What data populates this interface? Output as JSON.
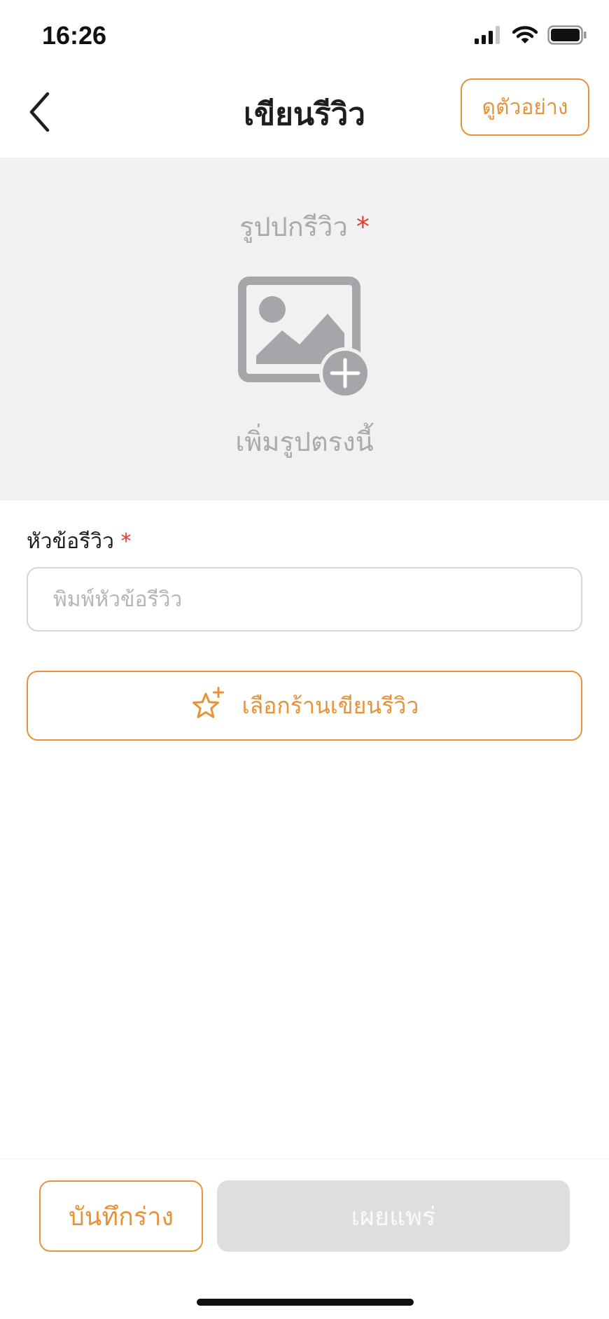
{
  "status_bar": {
    "time": "16:26"
  },
  "header": {
    "back_icon": "chevron-left-icon",
    "title": "เขียนรีวิว",
    "preview_label": "ดูตัวอย่าง"
  },
  "cover": {
    "label": "รูปปกรีวิว",
    "required_mark": "*",
    "icon": "add-image-icon",
    "hint": "เพิ่มรูปตรงนี้"
  },
  "title_field": {
    "label": "หัวข้อรีวิว",
    "required_mark": "*",
    "value": "",
    "placeholder": "พิมพ์หัวข้อรีวิว"
  },
  "shop_button": {
    "icon": "star-plus-icon",
    "label": "เลือกร้านเขียนรีวิว"
  },
  "footer": {
    "draft_label": "บันทึกร่าง",
    "publish_label": "เผยแพร่"
  },
  "colors": {
    "accent": "#e8923a",
    "required": "#e53935",
    "muted_text": "#a8aaae",
    "section_bg": "#f1f1f1",
    "disabled_button": "#dedee0"
  }
}
